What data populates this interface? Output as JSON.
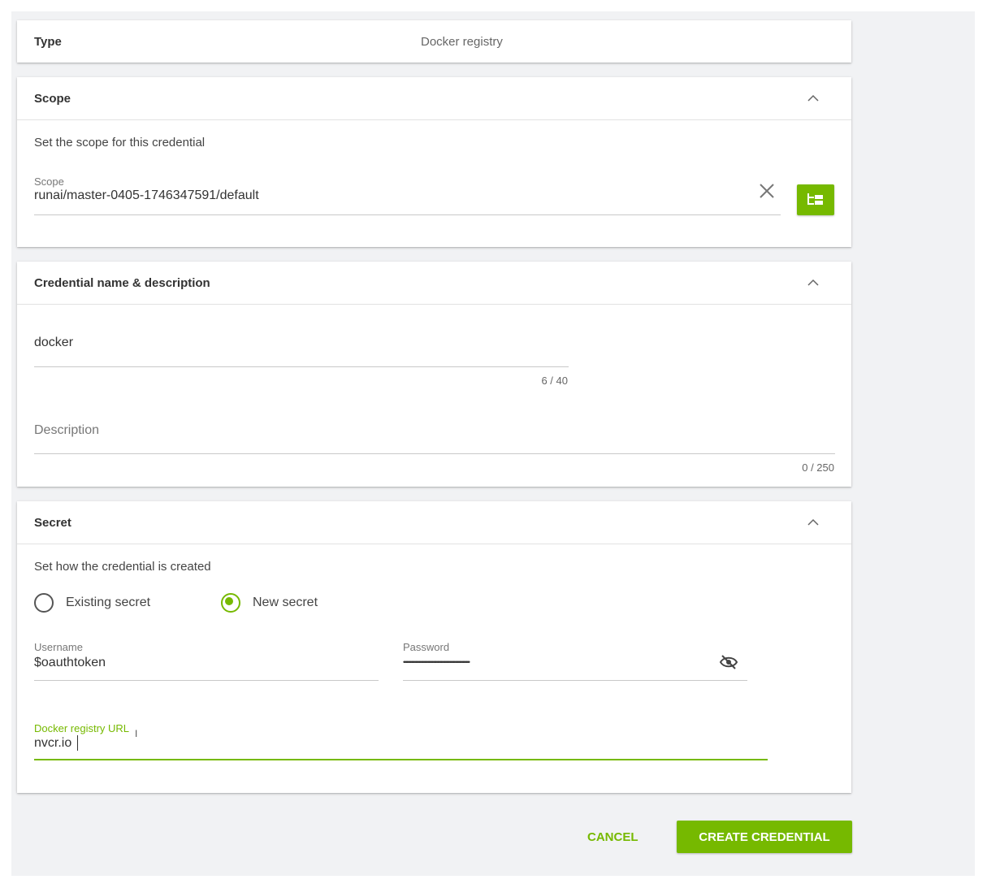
{
  "type_card": {
    "label": "Type",
    "value": "Docker registry"
  },
  "scope_card": {
    "title": "Scope",
    "subtitle": "Set the scope for this credential",
    "field_label": "Scope",
    "field_value": "runai/master-0405-1746347591/default"
  },
  "name_card": {
    "title": "Credential name & description",
    "name_value": "docker",
    "name_counter": "6 / 40",
    "description_placeholder": "Description",
    "description_counter": "0 / 250"
  },
  "secret_card": {
    "title": "Secret",
    "subtitle": "Set how the credential is created",
    "options": [
      {
        "label": "Existing secret",
        "selected": false
      },
      {
        "label": "New secret",
        "selected": true
      }
    ],
    "username_label": "Username",
    "username_value": "$oauthtoken",
    "password_label": "Password",
    "password_mask": "••••••••••••••••••••••••••••••••••••••••••••••••••••••••••••",
    "registry_label": "Docker registry URL",
    "registry_value": "nvcr.io"
  },
  "footer": {
    "cancel_label": "CANCEL",
    "create_label": "CREATE CREDENTIAL"
  },
  "colors": {
    "accent": "#76b900",
    "background": "#f1f2f4"
  }
}
